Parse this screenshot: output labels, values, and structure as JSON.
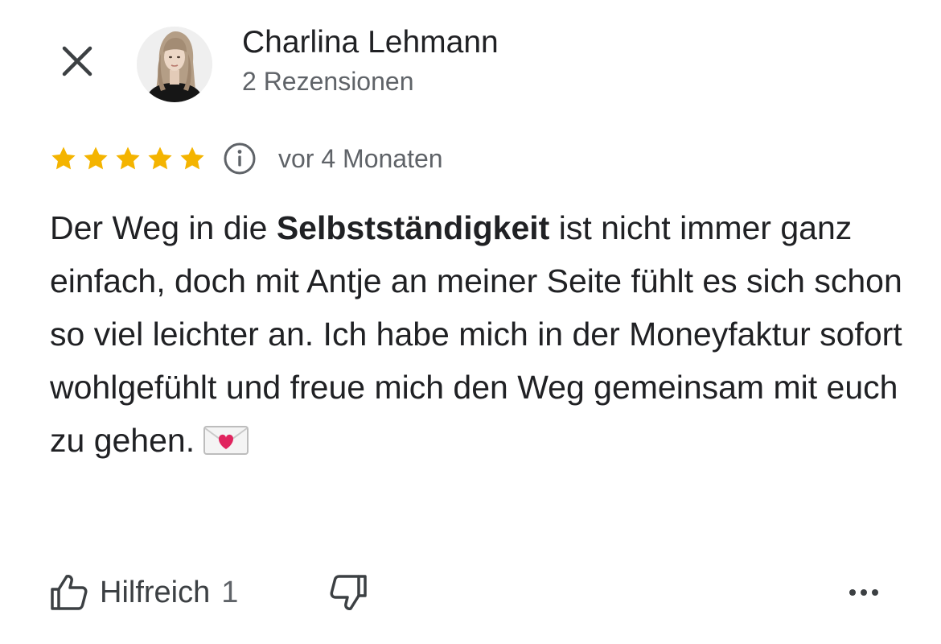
{
  "header": {
    "close_icon": "close-icon",
    "author": {
      "name": "Charlina Lehmann",
      "review_count": "2 Rezensionen",
      "avatar_icon": "avatar-photo"
    }
  },
  "review": {
    "rating": 5,
    "rating_max": 5,
    "star_color": "#f4b400",
    "info_icon": "info-icon",
    "time_ago": "vor 4 Monaten",
    "text_before": "Der Weg in die ",
    "text_bold": "Selbstständigkeit",
    "text_after": " ist nicht immer ganz einfach, doch mit Antje an meiner Seite fühlt es sich schon so viel leichter an. Ich habe mich in der  Moneyfaktur sofort wohlgefühlt und freue mich den Weg gemeinsam mit euch zu gehen.",
    "emoji_icon": "love-letter-icon"
  },
  "actions": {
    "helpful_label": "Hilfreich",
    "helpful_count": "1",
    "helpful_icon": "thumbs-up-icon",
    "dislike_icon": "thumbs-down-icon",
    "more_icon": "more-options-icon"
  }
}
